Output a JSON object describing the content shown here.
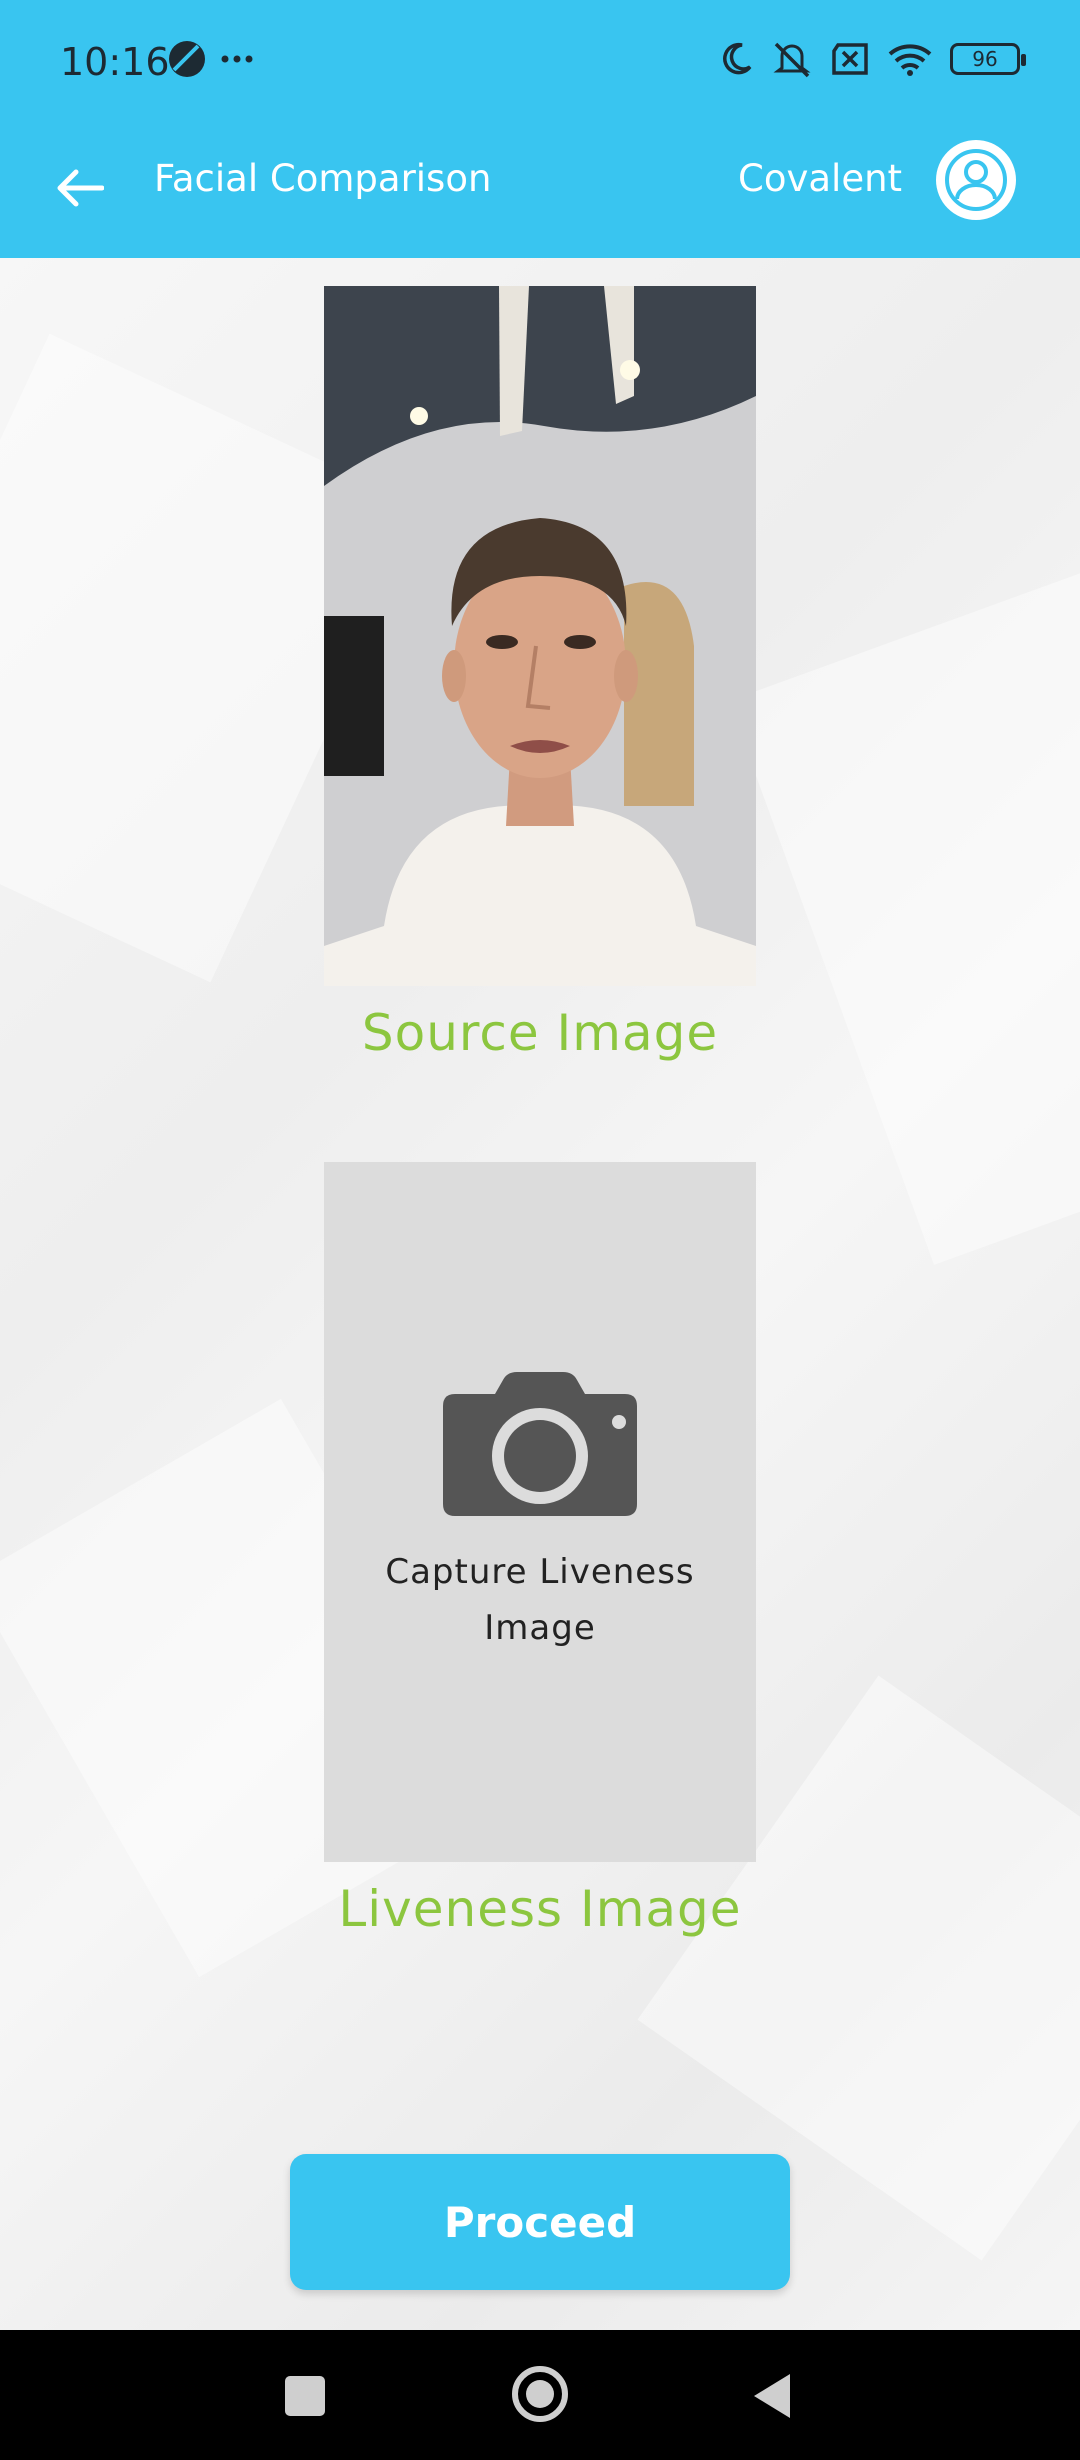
{
  "status_bar": {
    "time": "10:16",
    "battery": "96",
    "icons": [
      "vpn-icon",
      "more-icon",
      "moon-icon",
      "mute-icon",
      "sim-off-icon",
      "wifi-icon",
      "battery-icon"
    ]
  },
  "app_bar": {
    "title": "Facial Comparison",
    "user_name": "Covalent",
    "back_icon": "arrow-left-icon",
    "avatar_icon": "user-icon",
    "background": "#39c5f0"
  },
  "source": {
    "label": "Source Image"
  },
  "liveness": {
    "capture_line1": "Capture Liveness",
    "capture_line2": "Image",
    "label": "Liveness Image",
    "icon": "camera-icon"
  },
  "actions": {
    "proceed_label": "Proceed"
  },
  "colors": {
    "accent": "#39c5f0",
    "label_green": "#8cc63f"
  },
  "nav_bar": {
    "icons": [
      "recent-apps-icon",
      "home-icon",
      "back-icon"
    ]
  }
}
